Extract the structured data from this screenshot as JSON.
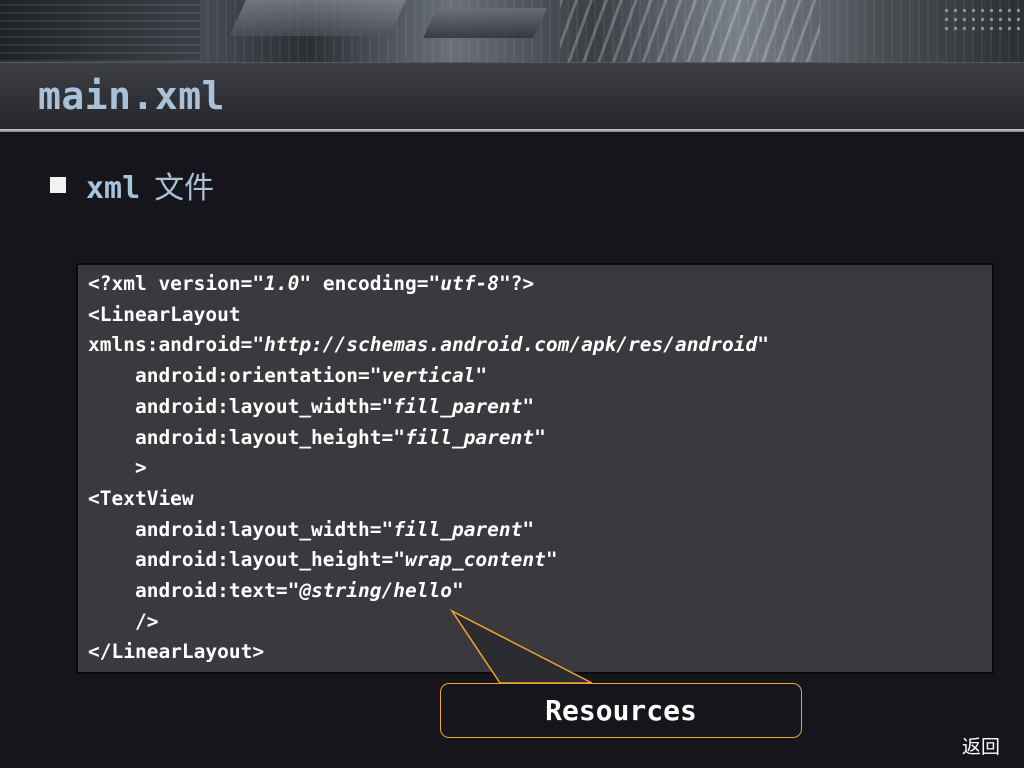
{
  "slide": {
    "title": "main.xml",
    "bullet": {
      "label": "xml",
      "label_cn": "文件"
    },
    "code": {
      "l1_a": "<?xml version=\"",
      "l1_v1": "1.0",
      "l1_b": "\" encoding=\"",
      "l1_v2": "utf-8",
      "l1_c": "\"?>",
      "l2": "<LinearLayout",
      "l3_a": "xmlns:android=\"",
      "l3_v": "http://schemas.android.com/apk/res/android",
      "l3_b": "\"",
      "l4_a": "    android:orientation=\"",
      "l4_v": "vertical",
      "l4_b": "\"",
      "l5_a": "    android:layout_width=\"",
      "l5_v": "fill_parent",
      "l5_b": "\"",
      "l6_a": "    android:layout_height=\"",
      "l6_v": "fill_parent",
      "l6_b": "\"",
      "l7": "    >",
      "l8": "<TextView",
      "l9_a": "    android:layout_width=\"",
      "l9_v": "fill_parent",
      "l9_b": "\"",
      "l10_a": "    android:layout_height=\"",
      "l10_v": "wrap_content",
      "l10_b": "\"",
      "l11_a": "    android:text=\"",
      "l11_v": "@string/hello",
      "l11_b": "\"",
      "l12": "    />",
      "l13": "</LinearLayout>"
    },
    "callout_label": "Resources",
    "back_label": "返回",
    "colors": {
      "title": "#a9c2da",
      "callout_border": "#f0a431",
      "code_bg": "#3a3a3e"
    }
  }
}
